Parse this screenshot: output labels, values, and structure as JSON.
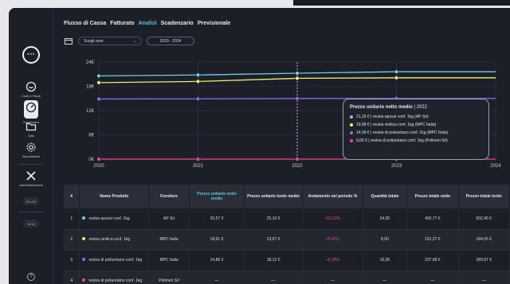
{
  "nav": {
    "logo": "···",
    "items": [
      {
        "label": "Conti e Flussi",
        "icon": "wallet-icon"
      },
      {
        "label": "Dashboard",
        "icon": "dashboard-icon",
        "active": true
      },
      {
        "label": "Dati",
        "icon": "folder-icon"
      },
      {
        "label": "Impostazioni",
        "icon": "gear-icon"
      },
      {
        "label": "Amministrazione",
        "icon": "tools-icon"
      }
    ],
    "pill1": "Pro-Sri",
    "pill2": "Mi m",
    "help": "?"
  },
  "tabs": [
    {
      "label": "Flusso di Cassa",
      "active": false
    },
    {
      "label": "Fatturato",
      "active": false
    },
    {
      "label": "Analisi",
      "active": true
    },
    {
      "label": "Scadenzario",
      "active": false
    },
    {
      "label": "Previsionale",
      "active": false
    }
  ],
  "filters": {
    "select_value": "Scegli anni",
    "range": "2020 - 2024"
  },
  "chart_data": {
    "type": "line",
    "x": [
      2020,
      2021,
      2022,
      2023,
      2024
    ],
    "y_ticks": [
      "24€",
      "18€",
      "12€",
      "6€",
      "0€"
    ],
    "ylim": [
      0,
      24
    ],
    "series": [
      {
        "values": [
          20.57,
          20.8,
          21.25,
          21.6,
          21.6
        ],
        "color": "#6fd0e3"
      },
      {
        "values": [
          18.91,
          19.2,
          19.98,
          20.1,
          20.1
        ],
        "color": "#eef07a"
      },
      {
        "values": [
          14.86,
          14.9,
          14.99,
          15.0,
          15.0
        ],
        "color": "#8a6cf2"
      },
      {
        "values": [
          0,
          0,
          0,
          0,
          0
        ],
        "color": "#f2439f"
      }
    ],
    "tooltip": {
      "title": "Prezzo unitario netto medio",
      "year": "| 2022",
      "rows": [
        {
          "text": "21,25 € | resina epossi conf. 1kg (AP Srl)",
          "color": "#6fd0e3"
        },
        {
          "text": "19,98 € | resina vinilica conf. 1kg (MPC Italia)",
          "color": "#eef07a"
        },
        {
          "text": "14,99 € | resina di poliuretano conf. 1kg (MPC Italia)",
          "color": "#8a6cf2"
        },
        {
          "text": "0,00 € | resina di poliuretano conf. 1kg (Polimeri Srl)",
          "color": "#f2439f"
        }
      ]
    }
  },
  "table": {
    "headers": [
      "#",
      "Nome Prodotto",
      "Fornitore",
      "Prezzo unitario netto medio",
      "Prezzo unitario lordo medio",
      "Andamento nel periodo %",
      "Quantità totale",
      "Prezzo totale netto",
      "Prezzo totale lordo"
    ],
    "rows": [
      {
        "n": "1",
        "name": "resina epossi conf. 1kg",
        "supplier": "AP Srl",
        "unit_net": "20,57 €",
        "unit_gross": "25,10 €",
        "trend": "+10,22%",
        "qty": "24,00",
        "tot_net": "493,77 €",
        "tot_gross": "602,40 €",
        "color": "#6fd0e3"
      },
      {
        "n": "2",
        "name": "resina vinilica conf. 1kg",
        "supplier": "MPC Italia",
        "unit_net": "18,91 €",
        "unit_gross": "23,07 €",
        "trend": "+5,47%",
        "qty": "8,00",
        "tot_net": "151,27 €",
        "tot_gross": "184,55 €",
        "color": "#eef07a"
      },
      {
        "n": "3",
        "name": "resina di poliuretano conf. 1kg",
        "supplier": "MPC Italia",
        "unit_net": "14,86 €",
        "unit_gross": "18,12 €",
        "trend": "+5,28%",
        "qty": "16,00",
        "tot_net": "237,68 €",
        "tot_gross": "289,97 €",
        "color": "#8a6cf2"
      },
      {
        "n": "4",
        "name": "resina di poliuretano conf. 1kg",
        "supplier": "Polimeri Srl",
        "unit_net": "—",
        "unit_gross": "—",
        "trend": "—",
        "qty": "—",
        "tot_net": "—",
        "tot_gross": "—",
        "color": "#f2439f"
      }
    ]
  }
}
